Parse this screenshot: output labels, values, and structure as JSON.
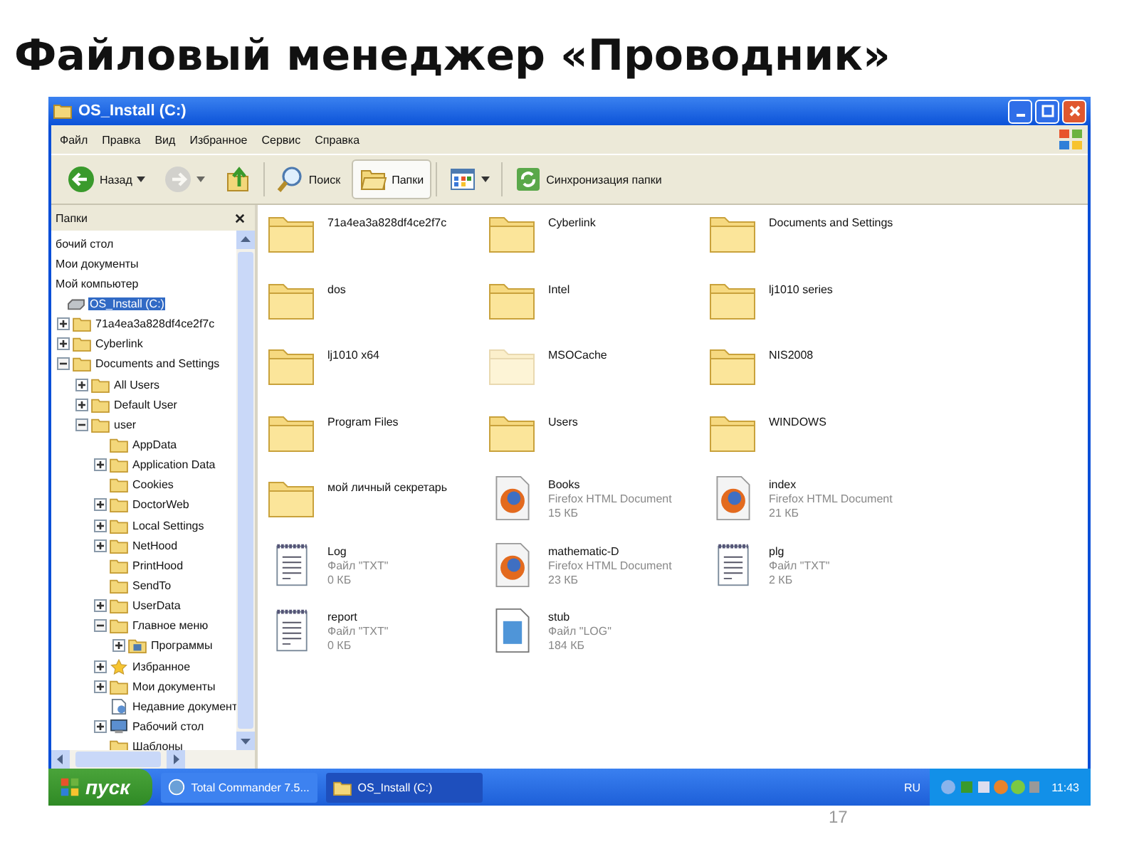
{
  "slide": {
    "title": "Файловый менеджер «Проводник»",
    "page_number": "17"
  },
  "window": {
    "title": "OS_Install (C:)"
  },
  "menu": [
    "Файл",
    "Правка",
    "Вид",
    "Избранное",
    "Сервис",
    "Справка"
  ],
  "toolbar": [
    {
      "kind": "back",
      "label": "Назад",
      "selected": false,
      "disabled": false
    },
    {
      "kind": "forward",
      "selected": false,
      "disabled": true
    },
    {
      "kind": "up",
      "selected": false,
      "disabled": false
    },
    {
      "kind": "search",
      "label": "Поиск",
      "selected": false,
      "disabled": false
    },
    {
      "kind": "folders",
      "label": "Папки",
      "selected": true,
      "disabled": false
    },
    {
      "kind": "views",
      "selected": false,
      "disabled": false
    },
    {
      "kind": "sync",
      "label": "Синхронизация папки",
      "selected": false,
      "disabled": false
    }
  ],
  "folders_pane": {
    "title": "Папки"
  },
  "tree": {
    "items": [
      {
        "label": "бочий стол",
        "kind": "none",
        "selected": false
      },
      {
        "label": "Мои документы",
        "kind": "none",
        "selected": false
      },
      {
        "label": "Мой компьютер",
        "kind": "none",
        "selected": false
      },
      {
        "label": "OS_Install (C:)",
        "kind": "drive",
        "selected": true,
        "children": [
          {
            "label": "71a4ea3a828df4ce2f7c",
            "kind": "folder",
            "expanded": false,
            "selected": false
          },
          {
            "label": "Cyberlink",
            "kind": "folder",
            "expanded": false,
            "selected": false
          },
          {
            "label": "Documents and Settings",
            "kind": "folder",
            "expanded": true,
            "selected": false,
            "children": [
              {
                "label": "All Users",
                "kind": "folder",
                "expanded": false,
                "selected": false
              },
              {
                "label": "Default User",
                "kind": "folder",
                "expanded": false,
                "selected": false
              },
              {
                "label": "user",
                "kind": "folder",
                "expanded": true,
                "selected": false,
                "children": [
                  {
                    "label": "AppData",
                    "kind": "folder",
                    "selected": false
                  },
                  {
                    "label": "Application Data",
                    "kind": "folder",
                    "expanded": false,
                    "selected": false
                  },
                  {
                    "label": "Cookies",
                    "kind": "folder",
                    "selected": false
                  },
                  {
                    "label": "DoctorWeb",
                    "kind": "folder",
                    "expanded": false,
                    "selected": false
                  },
                  {
                    "label": "Local Settings",
                    "kind": "folder",
                    "expanded": false,
                    "selected": false
                  },
                  {
                    "label": "NetHood",
                    "kind": "folder",
                    "expanded": false,
                    "selected": false
                  },
                  {
                    "label": "PrintHood",
                    "kind": "folder",
                    "selected": false
                  },
                  {
                    "label": "SendTo",
                    "kind": "folder",
                    "selected": false
                  },
                  {
                    "label": "UserData",
                    "kind": "folder",
                    "expanded": false,
                    "selected": false
                  },
                  {
                    "label": "Главное меню",
                    "kind": "folder",
                    "expanded": true,
                    "selected": false,
                    "children": [
                      {
                        "label": "Программы",
                        "kind": "programs",
                        "expanded": false,
                        "selected": false
                      }
                    ]
                  },
                  {
                    "label": "Избранное",
                    "kind": "star",
                    "expanded": false,
                    "selected": false
                  },
                  {
                    "label": "Мои документы",
                    "kind": "folder",
                    "expanded": false,
                    "selected": false
                  },
                  {
                    "label": "Недавние документ",
                    "kind": "recent",
                    "selected": false
                  },
                  {
                    "label": "Рабочий стол",
                    "kind": "desktop",
                    "expanded": false,
                    "selected": false
                  },
                  {
                    "label": "Шаблоны",
                    "kind": "folder",
                    "selected": false
                  }
                ]
              }
            ]
          }
        ]
      }
    ]
  },
  "files": [
    {
      "name": "71a4ea3a828df4ce2f7c",
      "kind": "folder",
      "hidden": false
    },
    {
      "name": "Cyberlink",
      "kind": "folder",
      "hidden": false
    },
    {
      "name": "Documents and Settings",
      "kind": "folder",
      "hidden": false
    },
    {
      "name": "dos",
      "kind": "folder",
      "hidden": false
    },
    {
      "name": "Intel",
      "kind": "folder",
      "hidden": false
    },
    {
      "name": "lj1010 series",
      "kind": "folder",
      "hidden": false
    },
    {
      "name": "lj1010 x64",
      "kind": "folder",
      "hidden": false
    },
    {
      "name": "MSOCache",
      "kind": "folder",
      "hidden": true
    },
    {
      "name": "NIS2008",
      "kind": "folder",
      "hidden": false
    },
    {
      "name": "Program Files",
      "kind": "folder",
      "hidden": false
    },
    {
      "name": "Users",
      "kind": "folder",
      "hidden": false
    },
    {
      "name": "WINDOWS",
      "kind": "folder",
      "hidden": false
    },
    {
      "name": "мой личный секретарь",
      "kind": "folder",
      "hidden": false
    },
    {
      "name": "Books",
      "type": "Firefox HTML Document",
      "size": "15 КБ",
      "kind": "html",
      "hidden": false
    },
    {
      "name": "index",
      "type": "Firefox HTML Document",
      "size": "21 КБ",
      "kind": "html",
      "hidden": false
    },
    {
      "name": "Log",
      "type": "Файл \"TXT\"",
      "size": "0 КБ",
      "kind": "txt",
      "hidden": false
    },
    {
      "name": "mathematic-D",
      "type": "Firefox HTML Document",
      "size": "23 КБ",
      "kind": "html",
      "hidden": false
    },
    {
      "name": "plg",
      "type": "Файл \"TXT\"",
      "size": "2 КБ",
      "kind": "txt",
      "hidden": false
    },
    {
      "name": "report",
      "type": "Файл \"TXT\"",
      "size": "0 КБ",
      "kind": "txt",
      "hidden": false
    },
    {
      "name": "stub",
      "type": "Файл \"LOG\"",
      "size": "184 КБ",
      "kind": "log",
      "hidden": false
    }
  ],
  "taskbar": {
    "start": "пуск",
    "tasks": [
      {
        "label": "Total Commander 7.5...",
        "kind": "tc",
        "selected": false
      },
      {
        "label": "OS_Install (C:)",
        "kind": "folder",
        "selected": true
      }
    ],
    "language": "RU",
    "clock": "11:43"
  }
}
